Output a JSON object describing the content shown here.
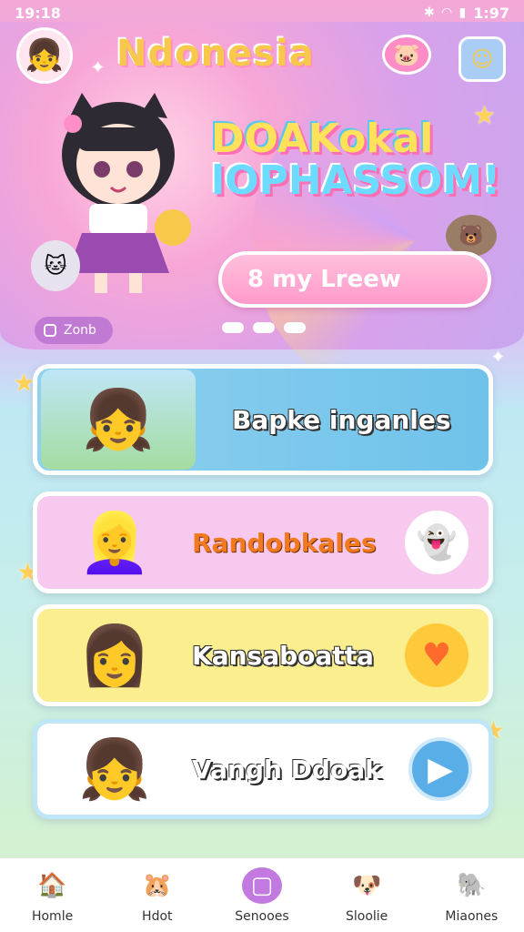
{
  "status_bar": {
    "time": "19:18",
    "battery": "1:97"
  },
  "header": {
    "app_title": "Ndonesia"
  },
  "hero": {
    "headline_line1": "DOAKokal",
    "headline_line2": "lOPHASSOM!",
    "cta_label": "8 my Lreew",
    "tag_label": "Zonb"
  },
  "cards": [
    {
      "title": "Bapke inganles"
    },
    {
      "title": "Randobkales"
    },
    {
      "title": "Kansaboatta"
    },
    {
      "title": "Vangh Ddoak"
    }
  ],
  "nav": {
    "items": [
      {
        "label": "Homle"
      },
      {
        "label": "Hdot"
      },
      {
        "label": "Senooes"
      },
      {
        "label": "Sloolie"
      },
      {
        "label": "Miaones"
      }
    ]
  },
  "colors": {
    "accent_pink": "#ff9acb",
    "accent_purple": "#c27ae0",
    "card_blue": "#6fc2ea",
    "card_pink": "#f8c9ee",
    "card_yellow": "#fbee8e"
  }
}
